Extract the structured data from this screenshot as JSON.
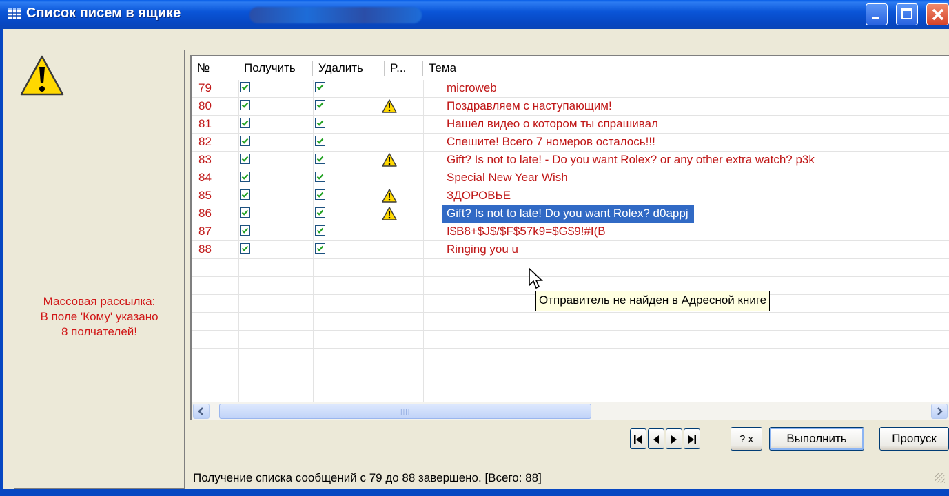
{
  "window": {
    "title": "Список писем в ящике"
  },
  "left_panel": {
    "message_lines": [
      "Массовая рассылка:",
      "В поле 'Кому' указано",
      "8 полчателей!"
    ]
  },
  "grid": {
    "columns": [
      "№",
      "Получить",
      "Удалить",
      "P...",
      "Тема"
    ],
    "rows": [
      {
        "num": "79",
        "get": true,
        "delete": true,
        "warn": false,
        "subject": "microweb"
      },
      {
        "num": "80",
        "get": true,
        "delete": true,
        "warn": true,
        "subject": "Поздравляем с наступающим!"
      },
      {
        "num": "81",
        "get": true,
        "delete": true,
        "warn": false,
        "subject": "Нашел видео о котором ты спрашивал"
      },
      {
        "num": "82",
        "get": true,
        "delete": true,
        "warn": false,
        "subject": "Спешите! Всего 7 номеров осталось!!!"
      },
      {
        "num": "83",
        "get": true,
        "delete": true,
        "warn": true,
        "subject": "Gift? Is not to late! - Do you want Rolex? or any other extra watch?    p3k"
      },
      {
        "num": "84",
        "get": true,
        "delete": true,
        "warn": false,
        "subject": "Special New Year Wish"
      },
      {
        "num": "85",
        "get": true,
        "delete": true,
        "warn": true,
        "subject": "ЗДОРОВЬЕ"
      },
      {
        "num": "86",
        "get": true,
        "delete": true,
        "warn": true,
        "subject": "Gift? Is not to late! Do you want Rolex?    d0appj",
        "selected": true
      },
      {
        "num": "87",
        "get": true,
        "delete": true,
        "warn": false,
        "subject": "I$B8+$J$/$F$57k9=$G$9!#I(B"
      },
      {
        "num": "88",
        "get": true,
        "delete": true,
        "warn": false,
        "subject": "Ringing you u"
      }
    ]
  },
  "tooltip": "Отправитель не найден в Адресной книге",
  "buttons": {
    "help": "? x",
    "run": "Выполнить",
    "skip": "Пропуск"
  },
  "status": "Получение списка сообщений с 79 до 88 завершено. [Всего: 88]"
}
